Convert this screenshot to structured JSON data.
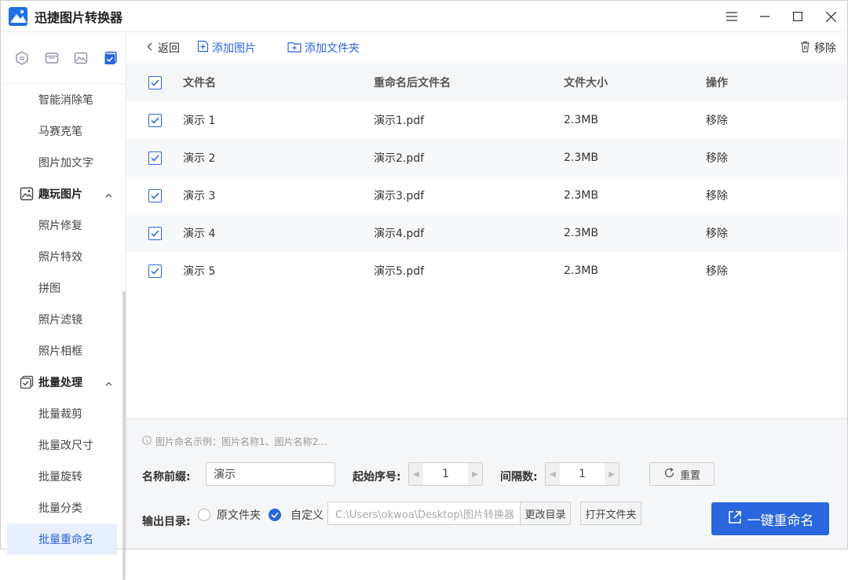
{
  "app": {
    "title": "迅捷图片转换器"
  },
  "sidebar": {
    "items_top": [
      "智能消除笔",
      "马赛克笔",
      "图片加文字"
    ],
    "group1": {
      "label": "趣玩图片",
      "items": [
        "照片修复",
        "照片特效",
        "拼图",
        "照片滤镜",
        "照片相框"
      ]
    },
    "group2": {
      "label": "批量处理",
      "items": [
        "批量裁剪",
        "批量改尺寸",
        "批量旋转",
        "批量分类",
        "批量重命名"
      ]
    }
  },
  "toolbar": {
    "back": "返回",
    "add_image": "添加图片",
    "add_folder": "添加文件夹",
    "remove": "移除"
  },
  "table": {
    "headers": {
      "name": "文件名",
      "renamed": "重命名后文件名",
      "size": "文件大小",
      "action": "操作"
    },
    "rows": [
      {
        "name": "演示 1",
        "renamed": "演示1.pdf",
        "size": "2.3MB",
        "action": "移除"
      },
      {
        "name": "演示 2",
        "renamed": "演示2.pdf",
        "size": "2.3MB",
        "action": "移除"
      },
      {
        "name": "演示 3",
        "renamed": "演示3.pdf",
        "size": "2.3MB",
        "action": "移除"
      },
      {
        "name": "演示 4",
        "renamed": "演示4.pdf",
        "size": "2.3MB",
        "action": "移除"
      },
      {
        "name": "演示 5",
        "renamed": "演示5.pdf",
        "size": "2.3MB",
        "action": "移除"
      }
    ]
  },
  "bottom": {
    "hint": "图片命名示例：图片名称1、图片名称2...",
    "prefix_label": "名称前缀:",
    "prefix_value": "演示",
    "start_label": "起始序号:",
    "start_value": "1",
    "interval_label": "间隔数:",
    "interval_value": "1",
    "reset": "重置",
    "output_label": "输出目录:",
    "opt_original": "原文件夹",
    "opt_custom": "自定义",
    "path": "C:\\Users\\okwoa\\Desktop\\图片转换器",
    "change_dir": "更改目录",
    "open_folder": "打开文件夹",
    "primary": "一键重命名"
  },
  "colors": {
    "accent": "#2a66dd",
    "row_alt": "#f7f8fa"
  }
}
